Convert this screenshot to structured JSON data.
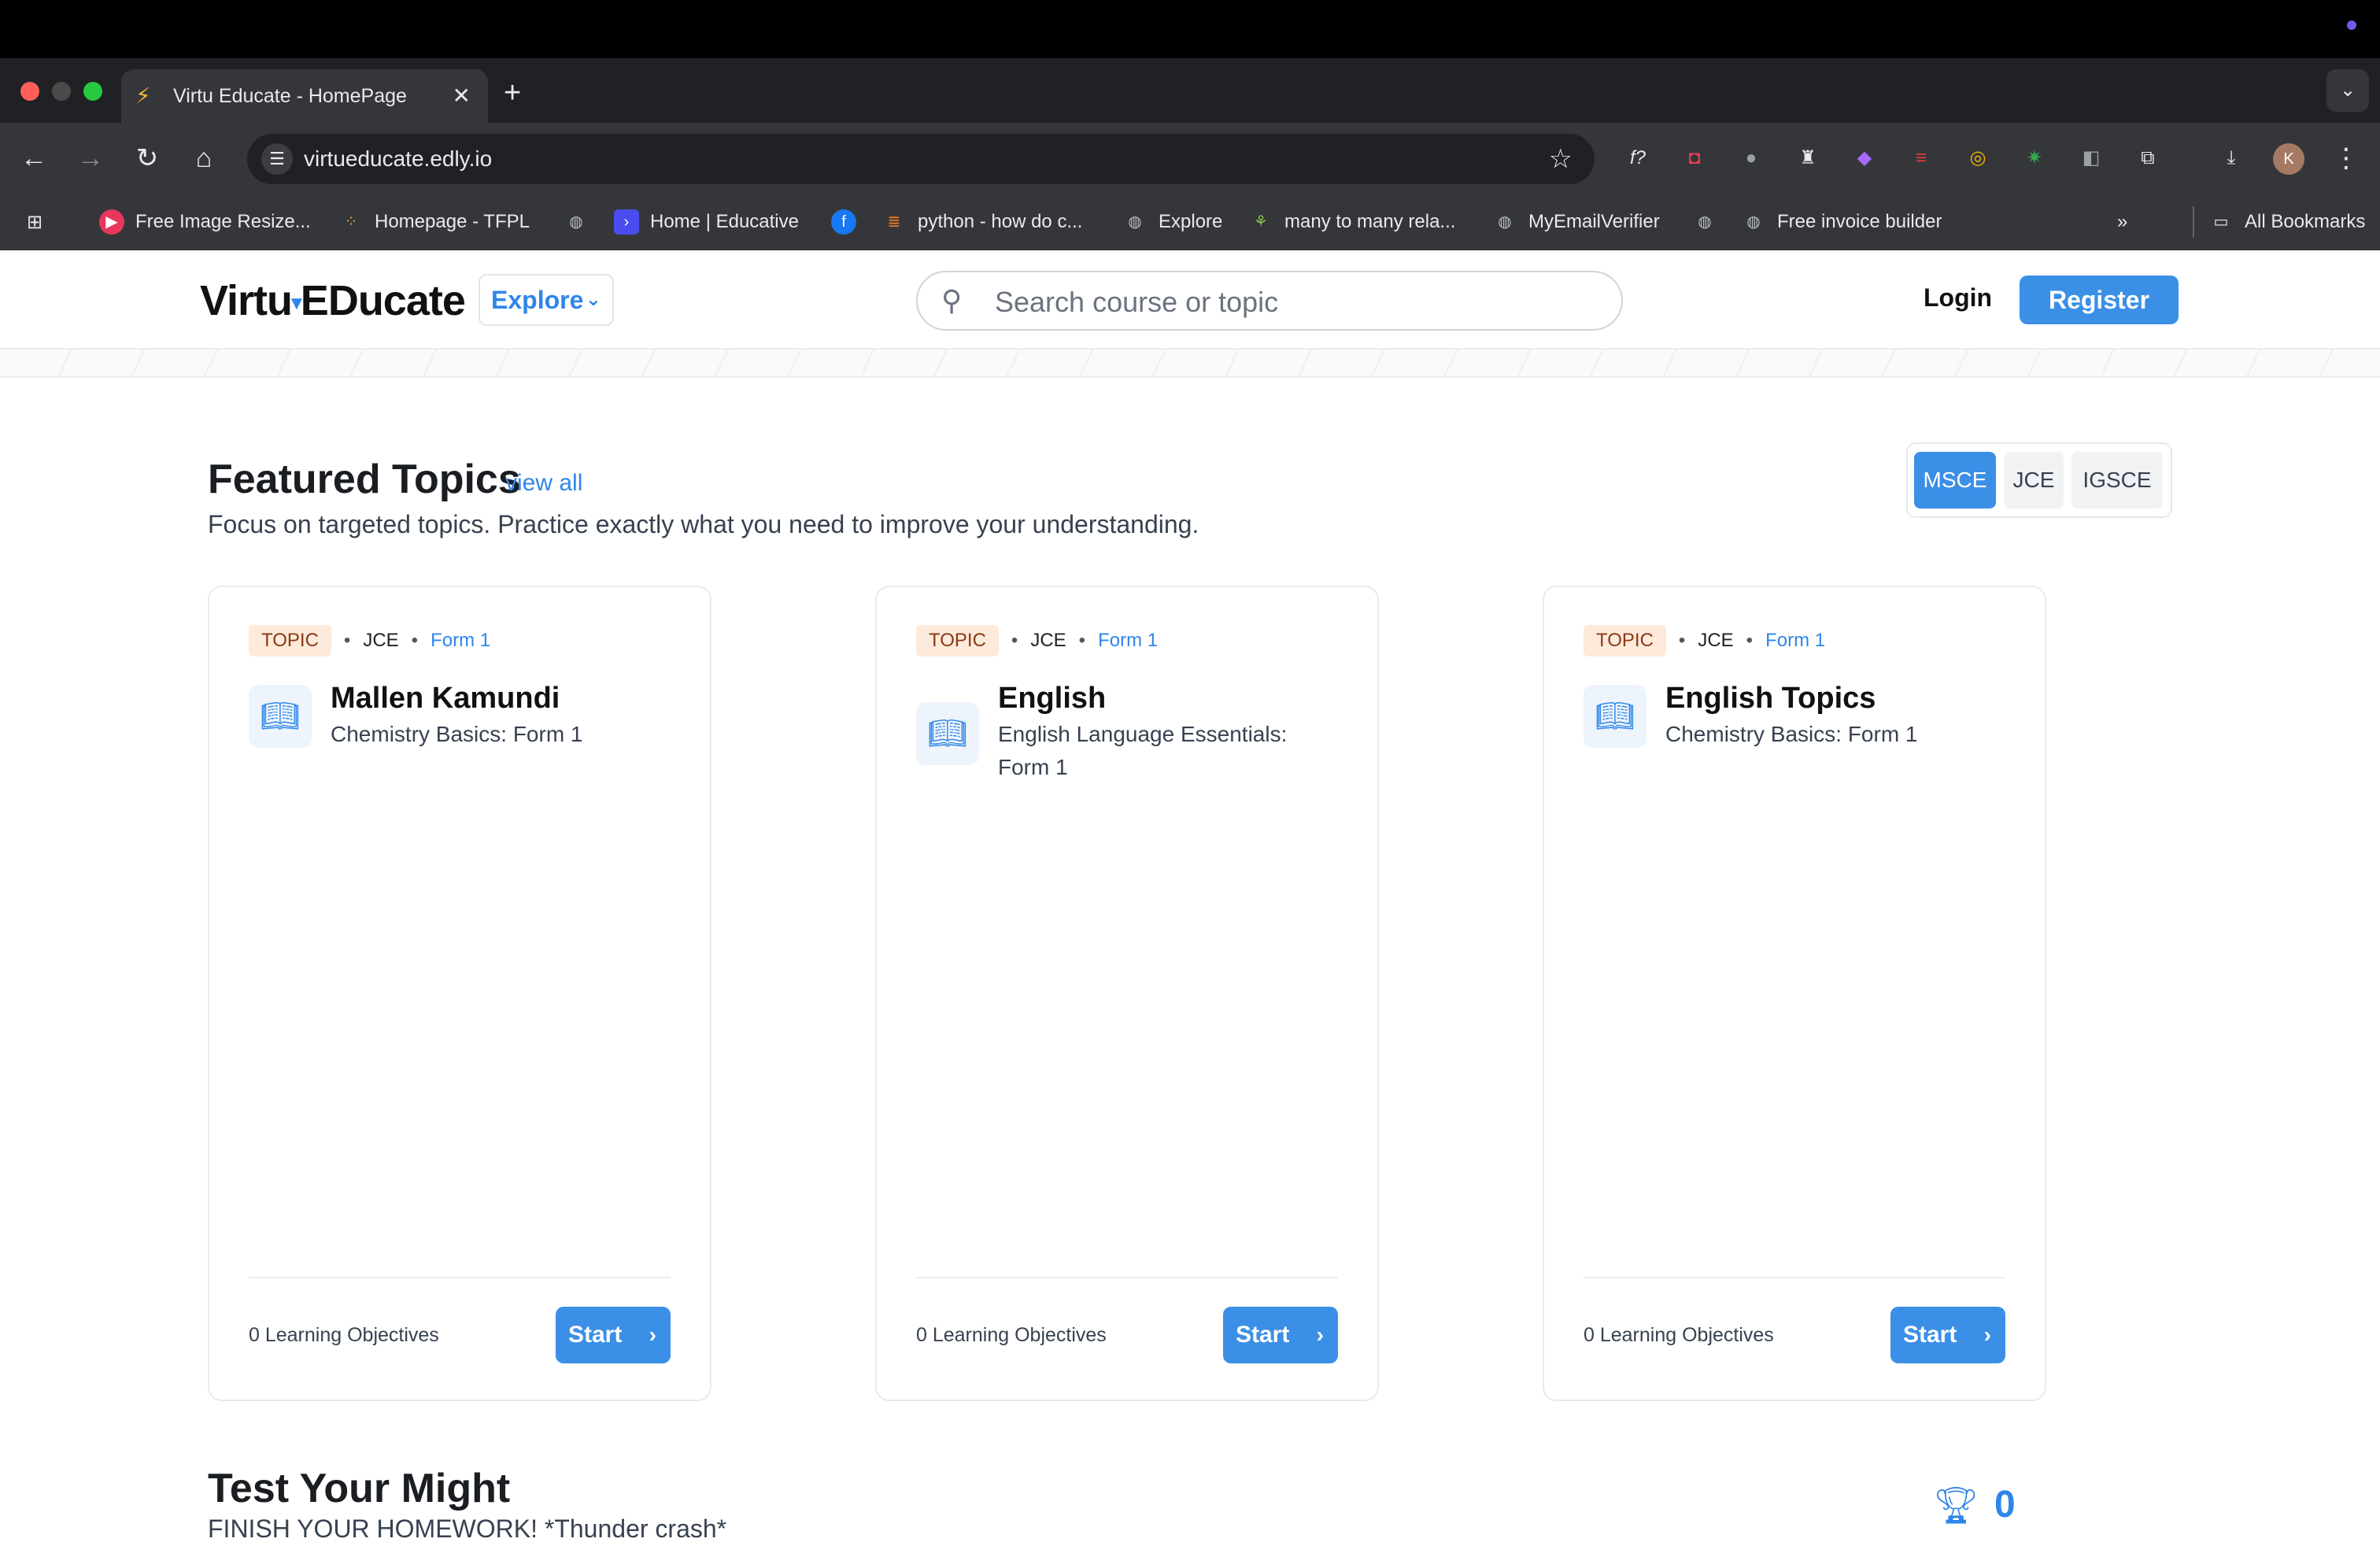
{
  "browser": {
    "tab_title": "Virtu Educate - HomePage",
    "url": "virtueducate.edly.io",
    "bookmarks": [
      {
        "label": "Free Image Resize...",
        "icon": "red-play-icon"
      },
      {
        "label": "Homepage - TFPL",
        "icon": "dots-icon"
      },
      {
        "label": "",
        "icon": "globe-icon"
      },
      {
        "label": "Home | Educative",
        "icon": "educative-icon"
      },
      {
        "label": "",
        "icon": "facebook-icon"
      },
      {
        "label": "python - how do c...",
        "icon": "stackoverflow-icon"
      },
      {
        "label": "Explore",
        "icon": "globe-icon"
      },
      {
        "label": "many to many rela...",
        "icon": "leaf-icon"
      },
      {
        "label": "MyEmailVerifier",
        "icon": "globe-icon"
      },
      {
        "label": "",
        "icon": "globe-icon"
      },
      {
        "label": "Free invoice builder",
        "icon": "globe-icon"
      }
    ],
    "all_bookmarks": "All Bookmarks",
    "profile_initial": "K"
  },
  "site": {
    "logo_left": "Virtu",
    "logo_right": "Ducate",
    "logo_e": "E",
    "explore_label": "Explore",
    "search_placeholder": "Search course or topic",
    "login_label": "Login",
    "register_label": "Register"
  },
  "featured": {
    "title": "Featured Topics",
    "view_all": "view all",
    "subtitle": "Focus on targeted topics. Practice exactly what you need to improve your understanding.",
    "exam_tabs": [
      "MSCE",
      "JCE",
      "IGSCE"
    ],
    "active_exam": "MSCE",
    "cards": [
      {
        "badge": "TOPIC",
        "level": "JCE",
        "form": "Form 1",
        "title": "Mallen Kamundi",
        "subtitle": "Chemistry Basics: Form 1",
        "objectives": "0 Learning Objectives",
        "start": "Start"
      },
      {
        "badge": "TOPIC",
        "level": "JCE",
        "form": "Form 1",
        "title": "English",
        "subtitle": "English Language Essentials: Form 1",
        "objectives": "0 Learning Objectives",
        "start": "Start"
      },
      {
        "badge": "TOPIC",
        "level": "JCE",
        "form": "Form 1",
        "title": "English Topics",
        "subtitle": "Chemistry Basics: Form 1",
        "objectives": "0 Learning Objectives",
        "start": "Start"
      }
    ]
  },
  "test_your_might": {
    "title": "Test Your Might",
    "subtitle": "FINISH YOUR HOMEWORK! *Thunder crash*",
    "score": "0"
  },
  "colors": {
    "accent": "#3b8fe6",
    "badge_bg": "#fdeadb",
    "chrome_dark": "#35363a"
  }
}
